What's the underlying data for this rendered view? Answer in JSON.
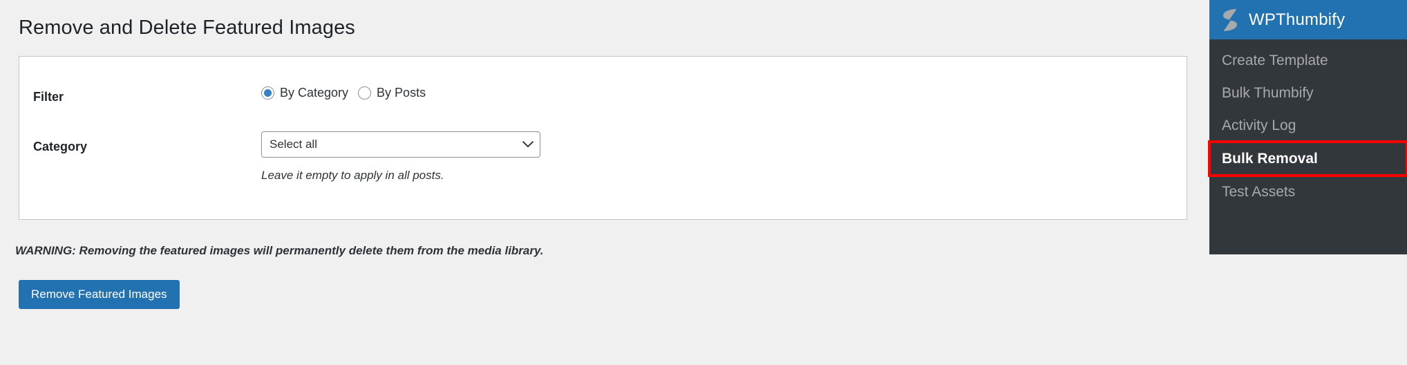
{
  "page": {
    "title": "Remove and Delete Featured Images"
  },
  "form": {
    "filter": {
      "label": "Filter",
      "options": [
        {
          "label": "By Category",
          "selected": true
        },
        {
          "label": "By Posts",
          "selected": false
        }
      ]
    },
    "category": {
      "label": "Category",
      "select_value": "Select all",
      "hint": "Leave it empty to apply in all posts."
    }
  },
  "warning": {
    "text": "WARNING: Removing the featured images will permanently delete them from the media library."
  },
  "actions": {
    "submit_label": "Remove Featured Images"
  },
  "sidebar": {
    "brand": "WPThumbify",
    "logo_icon": "wpthumbify-s-logo-icon",
    "items": [
      {
        "label": "Create Template",
        "active": false,
        "highlighted": false
      },
      {
        "label": "Bulk Thumbify",
        "active": false,
        "highlighted": false
      },
      {
        "label": "Activity Log",
        "active": false,
        "highlighted": false
      },
      {
        "label": "Bulk Removal",
        "active": true,
        "highlighted": true
      },
      {
        "label": "Test Assets",
        "active": false,
        "highlighted": false
      }
    ]
  },
  "colors": {
    "primary_blue": "#2271b1",
    "radio_blue": "#3582c4",
    "sidebar_bg": "#32373c",
    "page_bg": "#f0f0f1",
    "highlight_red": "#ff0000"
  }
}
